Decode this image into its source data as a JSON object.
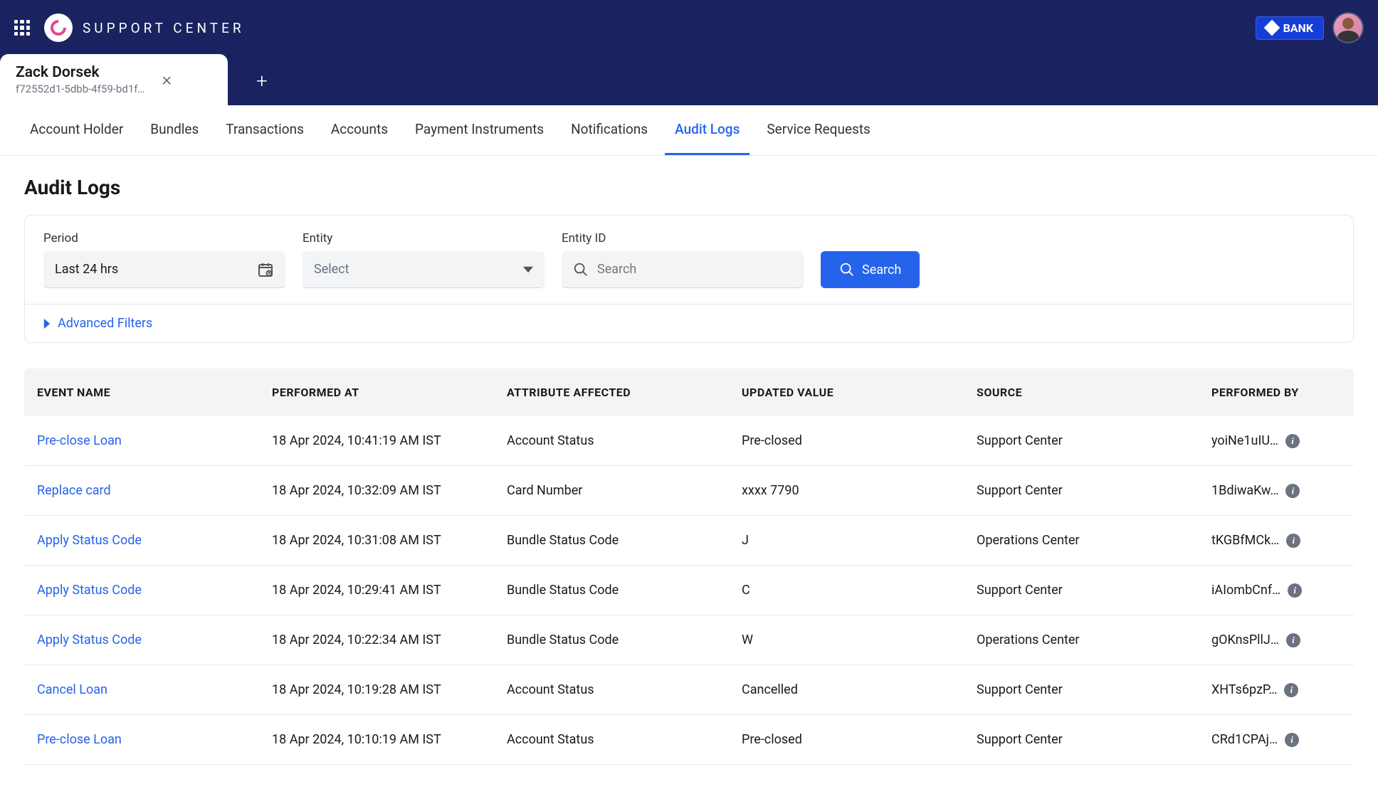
{
  "header": {
    "app_name": "SUPPORT CENTER",
    "bank_label": "BANK"
  },
  "doc_tab": {
    "title": "Zack Dorsek",
    "subtitle": "f72552d1-5dbb-4f59-bd1f…"
  },
  "nav": {
    "tabs": [
      {
        "label": "Account Holder",
        "active": false
      },
      {
        "label": "Bundles",
        "active": false
      },
      {
        "label": "Transactions",
        "active": false
      },
      {
        "label": "Accounts",
        "active": false
      },
      {
        "label": "Payment Instruments",
        "active": false
      },
      {
        "label": "Notifications",
        "active": false
      },
      {
        "label": "Audit Logs",
        "active": true
      },
      {
        "label": "Service Requests",
        "active": false
      }
    ]
  },
  "page": {
    "title": "Audit Logs"
  },
  "filters": {
    "period_label": "Period",
    "period_value": "Last 24 hrs",
    "entity_label": "Entity",
    "entity_placeholder": "Select",
    "entityid_label": "Entity ID",
    "entityid_placeholder": "Search",
    "search_btn": "Search",
    "advanced": "Advanced Filters"
  },
  "table": {
    "columns": [
      "EVENT NAME",
      "PERFORMED AT",
      "ATTRIBUTE AFFECTED",
      "UPDATED VALUE",
      "SOURCE",
      "PERFORMED BY"
    ],
    "rows": [
      {
        "event": "Pre-close Loan",
        "at": "18 Apr 2024, 10:41:19 AM IST",
        "attr": "Account Status",
        "val": "Pre-closed",
        "src": "Support Center",
        "by": "yoiNe1uIU…"
      },
      {
        "event": "Replace card",
        "at": "18 Apr 2024, 10:32:09 AM IST",
        "attr": "Card Number",
        "val": "xxxx 7790",
        "src": "Support Center",
        "by": "1BdiwaKw…"
      },
      {
        "event": "Apply Status Code",
        "at": "18 Apr 2024, 10:31:08 AM IST",
        "attr": "Bundle Status Code",
        "val": "J",
        "src": "Operations Center",
        "by": "tKGBfMCk…"
      },
      {
        "event": "Apply Status Code",
        "at": "18 Apr 2024, 10:29:41 AM IST",
        "attr": "Bundle Status Code",
        "val": "C",
        "src": "Support Center",
        "by": "iAIombCnf…"
      },
      {
        "event": "Apply Status Code",
        "at": "18 Apr 2024, 10:22:34 AM IST",
        "attr": "Bundle Status Code",
        "val": "W",
        "src": "Operations Center",
        "by": "gOKnsPllJ…"
      },
      {
        "event": "Cancel Loan",
        "at": "18 Apr 2024, 10:19:28 AM IST",
        "attr": "Account Status",
        "val": "Cancelled",
        "src": "Support Center",
        "by": "XHTs6pzP…"
      },
      {
        "event": "Pre-close Loan",
        "at": "18 Apr 2024, 10:10:19 AM IST",
        "attr": "Account Status",
        "val": "Pre-closed",
        "src": "Support Center",
        "by": "CRd1CPAj…"
      }
    ]
  }
}
